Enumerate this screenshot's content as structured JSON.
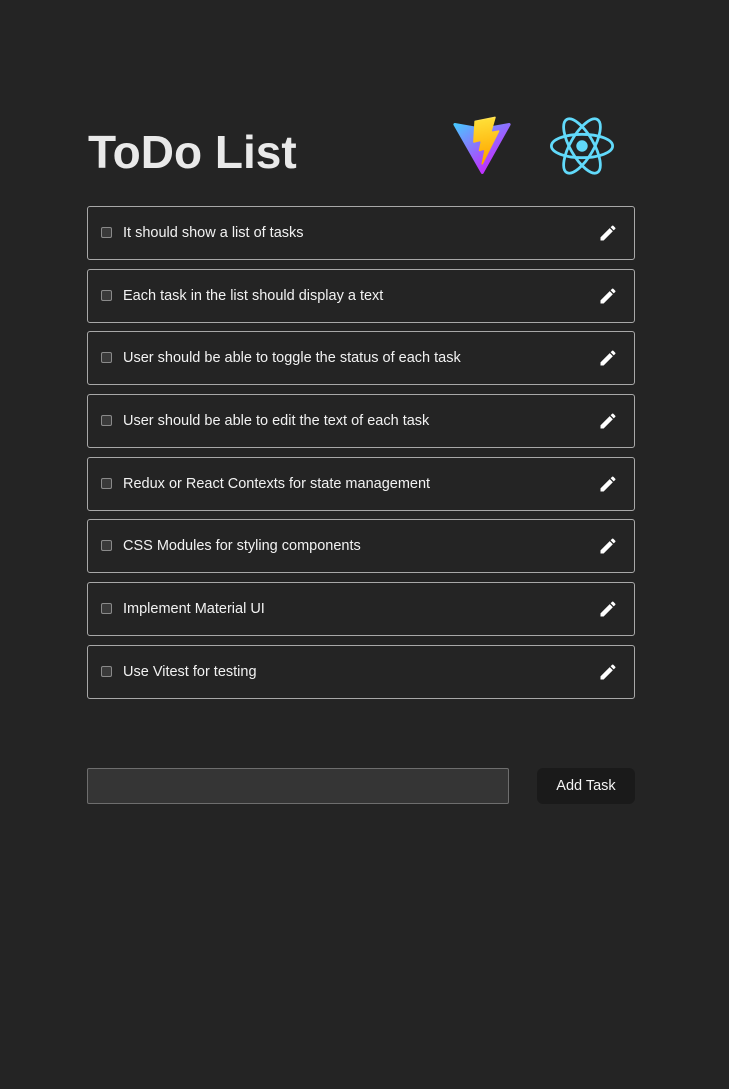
{
  "header": {
    "title": "ToDo List",
    "logos": [
      "vite-logo",
      "react-logo"
    ]
  },
  "tasks": [
    {
      "text": "It should show a list of tasks",
      "checked": false
    },
    {
      "text": "Each task in the list should display a text",
      "checked": false
    },
    {
      "text": "User should be able to toggle the status of each task",
      "checked": false
    },
    {
      "text": "User should be able to edit the text of each task",
      "checked": false
    },
    {
      "text": "Redux or React Contexts for state management",
      "checked": false
    },
    {
      "text": "CSS Modules for styling components",
      "checked": false
    },
    {
      "text": "Implement Material UI",
      "checked": false
    },
    {
      "text": "Use Vitest for testing",
      "checked": false
    }
  ],
  "form": {
    "input_value": "",
    "input_placeholder": "",
    "add_label": "Add Task"
  },
  "icons": {
    "edit": "pencil-icon",
    "checkbox": "checkbox-unchecked"
  },
  "colors": {
    "background": "#242424",
    "border": "#a8a8a8",
    "text": "#f2f2f2",
    "button_bg": "#1a1a1a",
    "input_bg": "#353535"
  }
}
